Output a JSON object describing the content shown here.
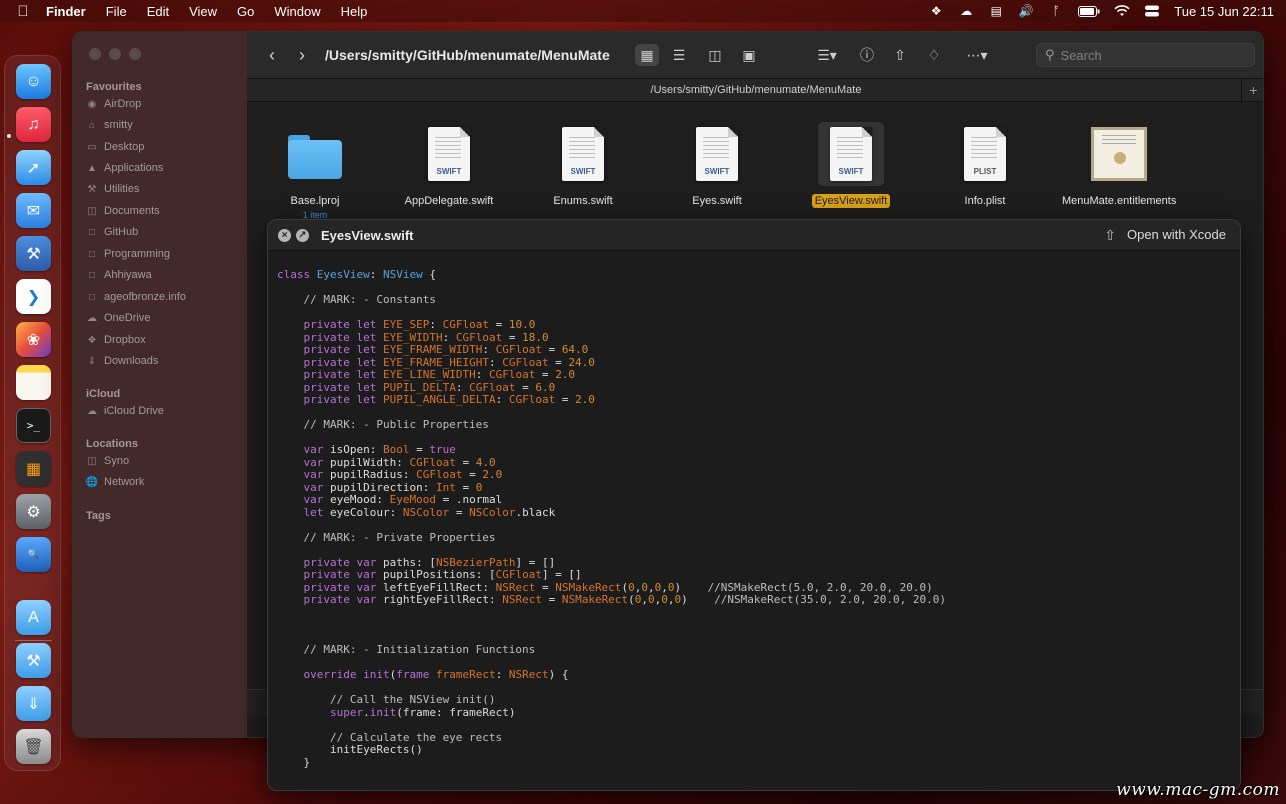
{
  "menubar": {
    "apple_icon": "apple-icon",
    "app_name": "Finder",
    "menus": [
      "File",
      "Edit",
      "View",
      "Go",
      "Window",
      "Help"
    ],
    "clock": "Tue 15 Jun  22:11"
  },
  "dock": {
    "apps": [
      "finder-icon",
      "music-icon",
      "safari-icon",
      "mail-icon",
      "xcode-icon",
      "vscode-icon",
      "pixelmator-icon",
      "notes-icon",
      "terminal-icon",
      "calculator-icon",
      "system-preferences-icon",
      "code-search-icon",
      "app-store-folder-icon",
      "utilities-folder-icon",
      "downloads-folder-icon",
      "trash-icon"
    ]
  },
  "finder": {
    "path_title": "/Users/smitty/GitHub/menumate/MenuMate",
    "pathbar": "/Users/smitty/GitHub/menumate/MenuMate",
    "search_placeholder": "Search",
    "sidebar": {
      "favourites_label": "Favourites",
      "favourites": [
        {
          "label": "AirDrop",
          "icon": "airdrop-icon"
        },
        {
          "label": "smitty",
          "icon": "home-icon"
        },
        {
          "label": "Desktop",
          "icon": "desktop-icon"
        },
        {
          "label": "Applications",
          "icon": "applications-icon"
        },
        {
          "label": "Utilities",
          "icon": "utilities-icon"
        },
        {
          "label": "Documents",
          "icon": "document-icon"
        },
        {
          "label": "GitHub",
          "icon": "folder-icon"
        },
        {
          "label": "Programming",
          "icon": "folder-icon"
        },
        {
          "label": "Ahhiyawa",
          "icon": "folder-icon"
        },
        {
          "label": "ageofbronze.info",
          "icon": "folder-icon"
        },
        {
          "label": "OneDrive",
          "icon": "cloud-icon"
        },
        {
          "label": "Dropbox",
          "icon": "dropbox-icon"
        },
        {
          "label": "Downloads",
          "icon": "download-icon"
        }
      ],
      "icloud_label": "iCloud",
      "icloud": [
        {
          "label": "iCloud Drive",
          "icon": "cloud-icon"
        }
      ],
      "locations_label": "Locations",
      "locations": [
        {
          "label": "Syno",
          "icon": "document-icon"
        },
        {
          "label": "Network",
          "icon": "network-icon"
        }
      ],
      "tags_label": "Tags"
    },
    "files": [
      {
        "name": "Base.lproj",
        "sub": "1 item",
        "kind": "folder"
      },
      {
        "name": "AppDelegate.swift",
        "tag": "SWIFT",
        "kind": "doc"
      },
      {
        "name": "Enums.swift",
        "tag": "SWIFT",
        "kind": "doc"
      },
      {
        "name": "Eyes.swift",
        "tag": "SWIFT",
        "kind": "doc"
      },
      {
        "name": "EyesView.swift",
        "tag": "SWIFT",
        "kind": "doc",
        "selected": true
      },
      {
        "name": "Info.plist",
        "tag": "PLIST",
        "kind": "doc"
      },
      {
        "name": "MenuMate.entitlements",
        "kind": "cert"
      }
    ]
  },
  "quicklook": {
    "title": "EyesView.swift",
    "open_button": "Open with Xcode",
    "code": [
      [
        [
          "kw",
          "class "
        ],
        [
          "tn",
          "EyesView"
        ],
        [
          "pl",
          ": "
        ],
        [
          "tn",
          "NSView"
        ],
        [
          "pl",
          " {"
        ]
      ],
      [],
      [
        [
          "cm",
          "    // MARK: - Constants"
        ]
      ],
      [],
      [
        [
          "pl",
          "    "
        ],
        [
          "kw",
          "private let "
        ],
        [
          "ty",
          "EYE_SEP"
        ],
        [
          "pl",
          ": "
        ],
        [
          "ty",
          "CGFloat"
        ],
        [
          "pl",
          " = "
        ],
        [
          "nm",
          "10.0"
        ]
      ],
      [
        [
          "pl",
          "    "
        ],
        [
          "kw",
          "private let "
        ],
        [
          "ty",
          "EYE_WIDTH"
        ],
        [
          "pl",
          ": "
        ],
        [
          "ty",
          "CGFloat"
        ],
        [
          "pl",
          " = "
        ],
        [
          "nm",
          "18.0"
        ]
      ],
      [
        [
          "pl",
          "    "
        ],
        [
          "kw",
          "private let "
        ],
        [
          "ty",
          "EYE_FRAME_WIDTH"
        ],
        [
          "pl",
          ": "
        ],
        [
          "ty",
          "CGFloat"
        ],
        [
          "pl",
          " = "
        ],
        [
          "nm",
          "64.0"
        ]
      ],
      [
        [
          "pl",
          "    "
        ],
        [
          "kw",
          "private let "
        ],
        [
          "ty",
          "EYE_FRAME_HEIGHT"
        ],
        [
          "pl",
          ": "
        ],
        [
          "ty",
          "CGFloat"
        ],
        [
          "pl",
          " = "
        ],
        [
          "nm",
          "24.0"
        ]
      ],
      [
        [
          "pl",
          "    "
        ],
        [
          "kw",
          "private let "
        ],
        [
          "ty",
          "EYE_LINE_WIDTH"
        ],
        [
          "pl",
          ": "
        ],
        [
          "ty",
          "CGFloat"
        ],
        [
          "pl",
          " = "
        ],
        [
          "nm",
          "2.0"
        ]
      ],
      [
        [
          "pl",
          "    "
        ],
        [
          "kw",
          "private let "
        ],
        [
          "ty",
          "PUPIL_DELTA"
        ],
        [
          "pl",
          ": "
        ],
        [
          "ty",
          "CGFloat"
        ],
        [
          "pl",
          " = "
        ],
        [
          "nm",
          "6.0"
        ]
      ],
      [
        [
          "pl",
          "    "
        ],
        [
          "kw",
          "private let "
        ],
        [
          "ty",
          "PUPIL_ANGLE_DELTA"
        ],
        [
          "pl",
          ": "
        ],
        [
          "ty",
          "CGFloat"
        ],
        [
          "pl",
          " = "
        ],
        [
          "nm",
          "2.0"
        ]
      ],
      [],
      [
        [
          "cm",
          "    // MARK: - Public Properties"
        ]
      ],
      [],
      [
        [
          "pl",
          "    "
        ],
        [
          "kw",
          "var "
        ],
        [
          "pl",
          "isOpen: "
        ],
        [
          "ty",
          "Bool"
        ],
        [
          "pl",
          " = "
        ],
        [
          "kw",
          "true"
        ]
      ],
      [
        [
          "pl",
          "    "
        ],
        [
          "kw",
          "var "
        ],
        [
          "pl",
          "pupilWidth: "
        ],
        [
          "ty",
          "CGFloat"
        ],
        [
          "pl",
          " = "
        ],
        [
          "nm",
          "4.0"
        ]
      ],
      [
        [
          "pl",
          "    "
        ],
        [
          "kw",
          "var "
        ],
        [
          "pl",
          "pupilRadius: "
        ],
        [
          "ty",
          "CGFloat"
        ],
        [
          "pl",
          " = "
        ],
        [
          "nm",
          "2.0"
        ]
      ],
      [
        [
          "pl",
          "    "
        ],
        [
          "kw",
          "var "
        ],
        [
          "pl",
          "pupilDirection: "
        ],
        [
          "ty",
          "Int"
        ],
        [
          "pl",
          " = "
        ],
        [
          "nm",
          "0"
        ]
      ],
      [
        [
          "pl",
          "    "
        ],
        [
          "kw",
          "var "
        ],
        [
          "pl",
          "eyeMood: "
        ],
        [
          "ty",
          "EyeMood"
        ],
        [
          "pl",
          " = .normal"
        ]
      ],
      [
        [
          "pl",
          "    "
        ],
        [
          "kw",
          "let "
        ],
        [
          "pl",
          "eyeColour: "
        ],
        [
          "ty",
          "NSColor"
        ],
        [
          "pl",
          " = "
        ],
        [
          "ty",
          "NSColor"
        ],
        [
          "pl",
          ".black"
        ]
      ],
      [],
      [
        [
          "cm",
          "    // MARK: - Private Properties"
        ]
      ],
      [],
      [
        [
          "pl",
          "    "
        ],
        [
          "kw",
          "private var "
        ],
        [
          "pl",
          "paths: ["
        ],
        [
          "ty",
          "NSBezierPath"
        ],
        [
          "pl",
          "] = []"
        ]
      ],
      [
        [
          "pl",
          "    "
        ],
        [
          "kw",
          "private var "
        ],
        [
          "pl",
          "pupilPositions: ["
        ],
        [
          "ty",
          "CGFloat"
        ],
        [
          "pl",
          "] = []"
        ]
      ],
      [
        [
          "pl",
          "    "
        ],
        [
          "kw",
          "private var "
        ],
        [
          "pl",
          "leftEyeFillRect: "
        ],
        [
          "ty",
          "NSRect"
        ],
        [
          "pl",
          " = "
        ],
        [
          "ty",
          "NSMakeRect"
        ],
        [
          "pl",
          "("
        ],
        [
          "nm",
          "0"
        ],
        [
          "pl",
          ","
        ],
        [
          "nm",
          "0"
        ],
        [
          "pl",
          ","
        ],
        [
          "nm",
          "0"
        ],
        [
          "pl",
          ","
        ],
        [
          "nm",
          "0"
        ],
        [
          "pl",
          ")    "
        ],
        [
          "cm",
          "//NSMakeRect(5.0, 2.0, 20.0, 20.0)"
        ]
      ],
      [
        [
          "pl",
          "    "
        ],
        [
          "kw",
          "private var "
        ],
        [
          "pl",
          "rightEyeFillRect: "
        ],
        [
          "ty",
          "NSRect"
        ],
        [
          "pl",
          " = "
        ],
        [
          "ty",
          "NSMakeRect"
        ],
        [
          "pl",
          "("
        ],
        [
          "nm",
          "0"
        ],
        [
          "pl",
          ","
        ],
        [
          "nm",
          "0"
        ],
        [
          "pl",
          ","
        ],
        [
          "nm",
          "0"
        ],
        [
          "pl",
          ","
        ],
        [
          "nm",
          "0"
        ],
        [
          "pl",
          ")    "
        ],
        [
          "cm",
          "//NSMakeRect(35.0, 2.0, 20.0, 20.0)"
        ]
      ],
      [],
      [],
      [],
      [
        [
          "cm",
          "    // MARK: - Initialization Functions"
        ]
      ],
      [],
      [
        [
          "pl",
          "    "
        ],
        [
          "kw",
          "override init"
        ],
        [
          "pl",
          "("
        ],
        [
          "kw",
          "frame "
        ],
        [
          "ty",
          "frameRect"
        ],
        [
          "pl",
          ": "
        ],
        [
          "ty",
          "NSRect"
        ],
        [
          "pl",
          ") {"
        ]
      ],
      [],
      [
        [
          "cm",
          "        // Call the NSView init()"
        ]
      ],
      [
        [
          "pl",
          "        "
        ],
        [
          "kw",
          "super"
        ],
        [
          "pl",
          "."
        ],
        [
          "kw",
          "init"
        ],
        [
          "pl",
          "(frame: frameRect)"
        ]
      ],
      [],
      [
        [
          "cm",
          "        // Calculate the eye rects"
        ]
      ],
      [
        [
          "pl",
          "        initEyeRects()"
        ]
      ],
      [
        [
          "pl",
          "    }"
        ]
      ]
    ]
  },
  "watermark": "www.mac-gm.com",
  "colors": {
    "selection": "#d9a21a",
    "folder": "#5bb4f0",
    "keyword": "#b86fd5",
    "type": "#d6732c"
  }
}
